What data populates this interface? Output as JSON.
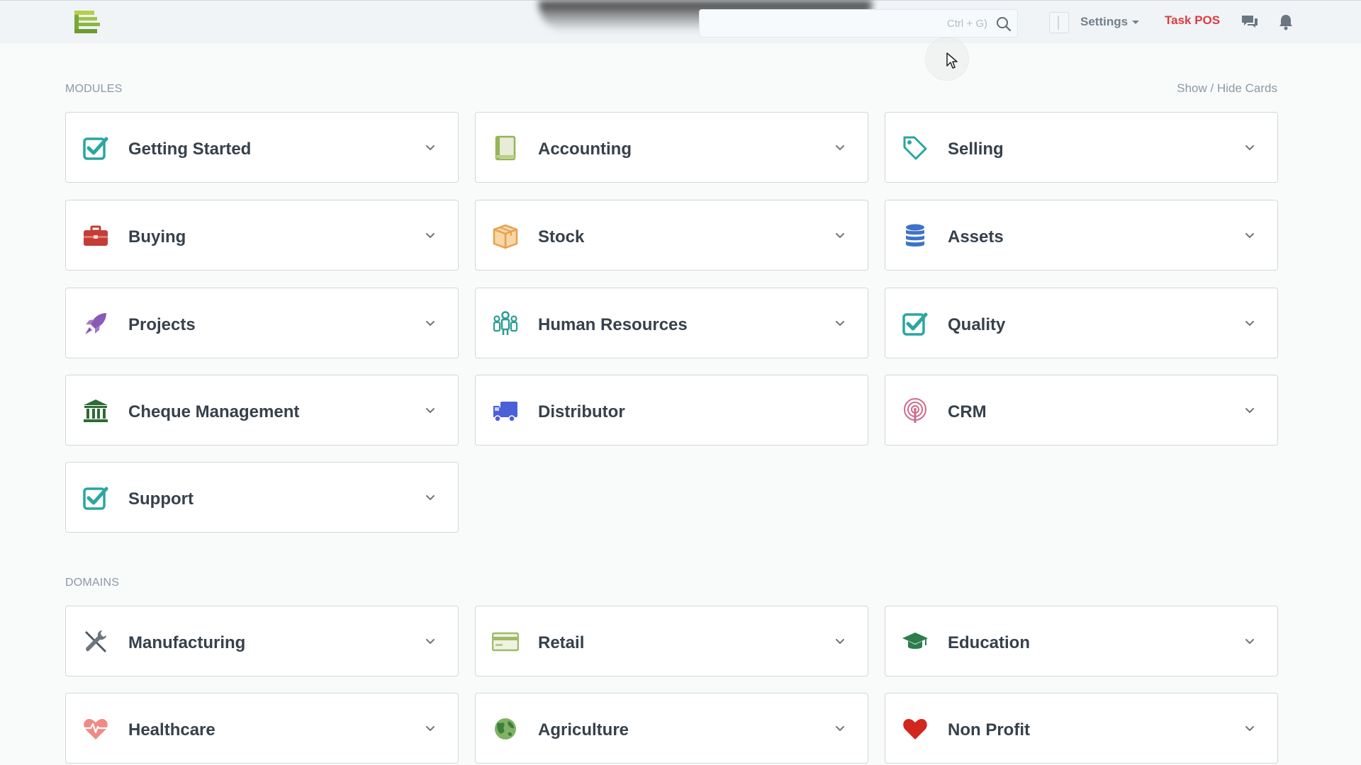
{
  "colors": {
    "task_pos": "#e0393e",
    "check_teal": "#2aa6a0",
    "buying_red": "#c43c36",
    "stock_orange": "#e8a04c",
    "assets_blue": "#3d73c9",
    "projects_purple": "#8a59b5",
    "hr_teal": "#2d9c93",
    "cheque_green": "#2f6b34",
    "distributor_blue": "#4b5fd7",
    "crm_pink": "#d16a8a",
    "education_green": "#2d7d4d",
    "healthcare_red": "#e5655c",
    "nonprofit_red": "#d2261f"
  },
  "navbar": {
    "brand_icon": "erpnext-logo-icon",
    "search": {
      "placeholder": "Ctrl + G)",
      "icon": "search-icon"
    },
    "settings_label": "Settings",
    "task_pos_label": "Task POS",
    "chat_icon": "chat-icon",
    "notification_icon": "bell-icon"
  },
  "modules": {
    "section_label": "MODULES",
    "show_hide_label": "Show / Hide Cards",
    "cards": [
      {
        "label": "Getting Started",
        "icon": "checkbox-icon",
        "has_dropdown": true
      },
      {
        "label": "Accounting",
        "icon": "ledger-book-icon",
        "has_dropdown": true
      },
      {
        "label": "Selling",
        "icon": "tag-icon",
        "has_dropdown": true
      },
      {
        "label": "Buying",
        "icon": "briefcase-icon",
        "has_dropdown": true
      },
      {
        "label": "Stock",
        "icon": "box-icon",
        "has_dropdown": true
      },
      {
        "label": "Assets",
        "icon": "database-icon",
        "has_dropdown": true
      },
      {
        "label": "Projects",
        "icon": "rocket-icon",
        "has_dropdown": true
      },
      {
        "label": "Human Resources",
        "icon": "people-icon",
        "has_dropdown": true
      },
      {
        "label": "Quality",
        "icon": "checkbox-icon",
        "has_dropdown": true
      },
      {
        "label": "Cheque Management",
        "icon": "bank-icon",
        "has_dropdown": true
      },
      {
        "label": "Distributor",
        "icon": "truck-icon",
        "has_dropdown": false
      },
      {
        "label": "CRM",
        "icon": "broadcast-icon",
        "has_dropdown": true
      },
      {
        "label": "Support",
        "icon": "checkbox-icon",
        "has_dropdown": true
      }
    ]
  },
  "domains": {
    "section_label": "DOMAINS",
    "cards": [
      {
        "label": "Manufacturing",
        "icon": "tools-icon",
        "has_dropdown": true
      },
      {
        "label": "Retail",
        "icon": "credit-card-icon",
        "has_dropdown": true
      },
      {
        "label": "Education",
        "icon": "graduation-cap-icon",
        "has_dropdown": true
      },
      {
        "label": "Healthcare",
        "icon": "heartbeat-icon",
        "has_dropdown": true
      },
      {
        "label": "Agriculture",
        "icon": "globe-icon",
        "has_dropdown": true
      },
      {
        "label": "Non Profit",
        "icon": "heart-icon",
        "has_dropdown": true
      }
    ]
  }
}
